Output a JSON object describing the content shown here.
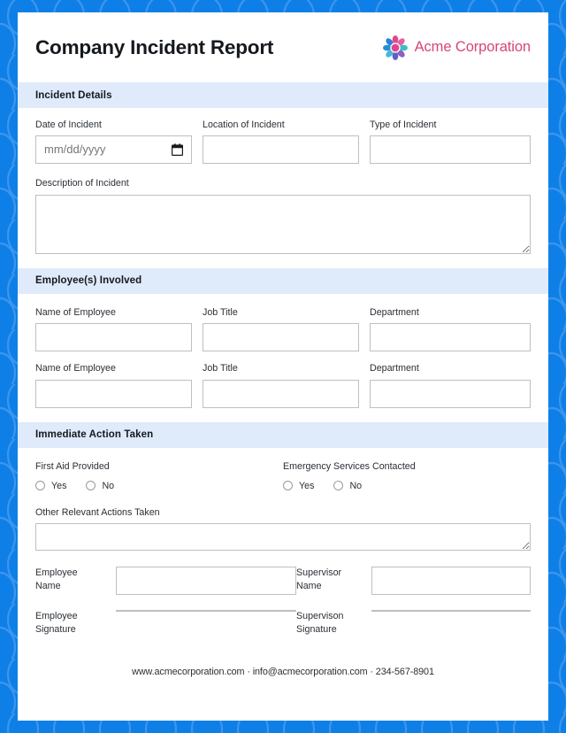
{
  "document": {
    "title": "Company Incident Report",
    "brand": {
      "name": "Acme Corporation",
      "logo_icon": "flower-logo-icon",
      "name_color": "#d8447c"
    },
    "page_bg_color": "#0f7fe8",
    "section_band_color": "#dfeafb"
  },
  "sections": [
    {
      "id": "incident-details",
      "title": "Incident Details",
      "fields": [
        {
          "label": "Date of Incident",
          "value": "",
          "placeholder": "mm/dd/yyyy",
          "type": "date",
          "icon": "calendar-icon"
        },
        {
          "label": "Location of Incident",
          "value": "",
          "placeholder": "",
          "type": "text"
        },
        {
          "label": "Type of Incident",
          "value": "",
          "placeholder": "",
          "type": "text"
        },
        {
          "label": "Description of Incident",
          "value": "",
          "placeholder": "",
          "type": "textarea"
        }
      ]
    },
    {
      "id": "employees-involved",
      "title": "Employee(s) Involved",
      "rows": [
        {
          "fields": [
            {
              "label": "Name of Employee",
              "value": "",
              "placeholder": ""
            },
            {
              "label": "Job Title",
              "value": "",
              "placeholder": ""
            },
            {
              "label": "Department",
              "value": "",
              "placeholder": ""
            }
          ]
        },
        {
          "fields": [
            {
              "label": "Name of Employee",
              "value": "",
              "placeholder": ""
            },
            {
              "label": "Job Title",
              "value": "",
              "placeholder": ""
            },
            {
              "label": "Department",
              "value": "",
              "placeholder": ""
            }
          ]
        }
      ]
    },
    {
      "id": "immediate-action-taken",
      "title": "Immediate Action Taken",
      "radio_questions": [
        {
          "label": "First Aid Provided",
          "options": [
            {
              "label": "Yes",
              "selected": false
            },
            {
              "label": "No",
              "selected": false
            }
          ]
        },
        {
          "label": "Emergency Services Contacted",
          "options": [
            {
              "label": "Yes",
              "selected": false
            },
            {
              "label": "No",
              "selected": false
            }
          ]
        }
      ],
      "other_actions": {
        "label": "Other Relevant Actions Taken",
        "value": "",
        "placeholder": ""
      },
      "signoff": [
        {
          "left": {
            "label": "Employee\nName",
            "value": ""
          },
          "right": {
            "label": "Supervisor\nName",
            "value": ""
          }
        },
        {
          "left": {
            "label": "Employee\nSignature",
            "value": ""
          },
          "right": {
            "label": "Supervison\nSignature",
            "value": ""
          }
        }
      ]
    }
  ],
  "footer": {
    "text": "www.acmecorporation.com · info@acmecorporation.com · 234-567-8901",
    "website": "www.acmecorporation.com",
    "email": "info@acmecorporation.com",
    "phone": "234-567-8901"
  }
}
